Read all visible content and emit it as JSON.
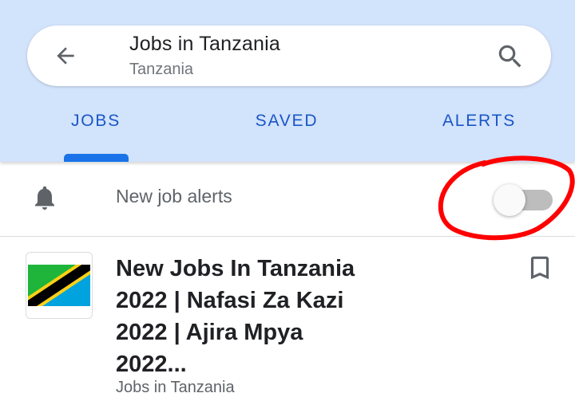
{
  "search": {
    "title": "Jobs in Tanzania",
    "subtitle": "Tanzania"
  },
  "tabs": [
    {
      "label": "JOBS",
      "selected": true
    },
    {
      "label": "SAVED",
      "selected": false
    },
    {
      "label": "ALERTS",
      "selected": false
    }
  ],
  "alerts": {
    "label": "New job alerts",
    "enabled": false
  },
  "jobs": [
    {
      "title": "New Jobs In Tanzania\n2022 | Nafasi Za Kazi\n2022 | Ajira Mpya\n2022...",
      "source": "Jobs in Tanzania",
      "logo": "tanzania-flag",
      "saved": false
    }
  ],
  "colors": {
    "header_bg": "#d2e3fc",
    "accent": "#1a73e8",
    "tab_text": "#1a56c7",
    "annotation": "#ff0000"
  },
  "icons": [
    "back-arrow-icon",
    "search-icon",
    "bell-icon",
    "bookmark-icon"
  ]
}
